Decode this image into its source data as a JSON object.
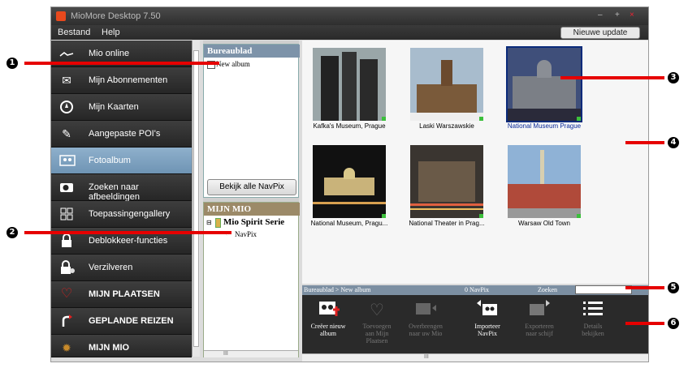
{
  "window": {
    "title": "MioMore Desktop 7.50",
    "controls": [
      "–",
      "+",
      "×"
    ]
  },
  "menu": {
    "items": [
      "Bestand",
      "Help"
    ],
    "update_button": "Nieuwe update"
  },
  "nav": {
    "items": [
      {
        "label": "Mio online",
        "icon": "mio-wave-icon"
      },
      {
        "label": "Mijn Abonnementen",
        "icon": "envelope-icon"
      },
      {
        "label": "Mijn Kaarten",
        "icon": "compass-icon"
      },
      {
        "label": "Aangepaste POI's",
        "icon": "pen-icon"
      },
      {
        "label": "Fotoalbum",
        "icon": "photo-album-icon"
      },
      {
        "label": "Zoeken naar afbeeldingen",
        "icon": "camera-icon"
      },
      {
        "label": "Toepassingengallery",
        "icon": "apps-grid-icon"
      },
      {
        "label": "Deblokkeer-functies",
        "icon": "lock-icon"
      },
      {
        "label": "Verzilveren",
        "icon": "lock-money-icon"
      },
      {
        "label": "MIJN PLAATSEN",
        "icon": "heart-icon"
      },
      {
        "label": "GEPLANDE REIZEN",
        "icon": "route-icon"
      },
      {
        "label": "MIJN MIO",
        "icon": "gear-icon"
      }
    ]
  },
  "albums": {
    "header": "Bureaublad",
    "new_album": "New album",
    "view_all_button": "Bekijk alle NavPix"
  },
  "mymio": {
    "header": "MIJN MIO",
    "device": "Mio Spirit Serie",
    "navpix": "NavPix"
  },
  "scroll_glyph": "III",
  "photos": [
    {
      "caption": "Kafka's Museum, Prague"
    },
    {
      "caption": "Laski Warszawskie"
    },
    {
      "caption": "National Museum Prague"
    },
    {
      "caption": "National Museum, Pragu..."
    },
    {
      "caption": "National Theater in Prag..."
    },
    {
      "caption": "Warsaw Old Town"
    }
  ],
  "statusbar": {
    "path": "Bureaublad > New album",
    "count": "0 NavPix",
    "search_label": "Zoeken"
  },
  "toolbar": [
    {
      "line1": "Creëer nieuw",
      "line2": "album",
      "enabled": true
    },
    {
      "line1": "Toevoegen",
      "line2": "aan Mijn Plaatsen",
      "enabled": false
    },
    {
      "line1": "Overbrengen",
      "line2": "naar uw Mio",
      "enabled": false
    },
    {
      "line1": "Importeer",
      "line2": "NavPix",
      "enabled": true
    },
    {
      "line1": "Exporteren",
      "line2": "naar schijf",
      "enabled": false
    },
    {
      "line1": "Details",
      "line2": "bekijken",
      "enabled": false
    }
  ],
  "callouts": [
    "1",
    "2",
    "3",
    "4",
    "5",
    "6"
  ],
  "colors": {
    "accent_red": "#e60000",
    "nav_active": "#7fa3c2",
    "selection_blue": "#0a2a7a"
  }
}
